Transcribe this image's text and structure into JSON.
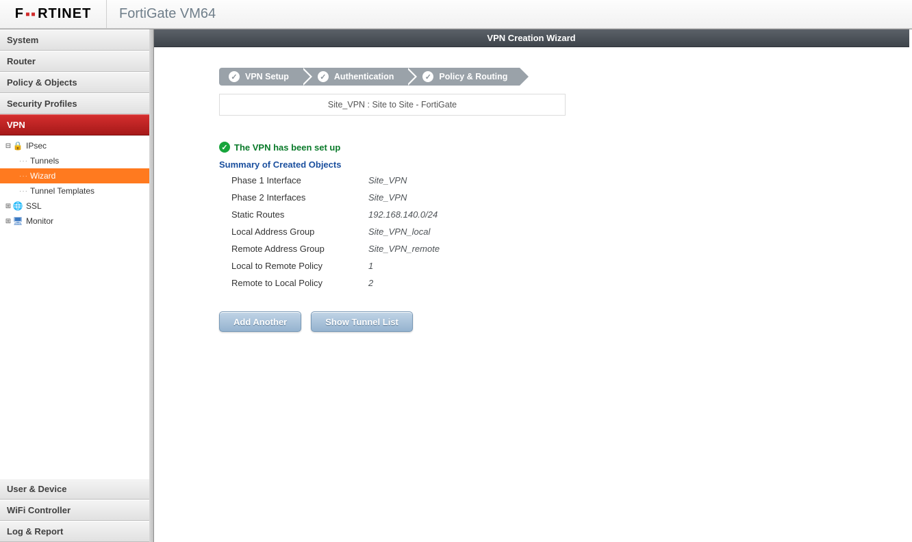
{
  "header": {
    "brand_prefix": "F",
    "brand_red": "▪▪",
    "brand_suffix": "RTINET",
    "product": "FortiGate VM64"
  },
  "sidebar": {
    "top": [
      "System",
      "Router",
      "Policy & Objects",
      "Security Profiles"
    ],
    "active": "VPN",
    "tree": {
      "ipsec": "IPsec",
      "tunnels": "Tunnels",
      "wizard": "Wizard",
      "templates": "Tunnel Templates",
      "ssl": "SSL",
      "monitor": "Monitor"
    },
    "bottom": [
      "User & Device",
      "WiFi Controller",
      "Log & Report"
    ]
  },
  "page": {
    "title": "VPN Creation Wizard",
    "steps": [
      "VPN Setup",
      "Authentication",
      "Policy & Routing"
    ],
    "info_line": "Site_VPN : Site to Site - FortiGate",
    "success": "The VPN has been set up",
    "summary_title": "Summary of Created Objects",
    "rows": {
      "phase1_k": "Phase 1 Interface",
      "phase1_v": "Site_VPN",
      "phase2_k": "Phase 2 Interfaces",
      "phase2_v": "Site_VPN",
      "routes_k": "Static Routes",
      "routes_v": "192.168.140.0/24",
      "lag_k": "Local Address Group",
      "lag_v": "Site_VPN_local",
      "rag_k": "Remote Address Group",
      "rag_v": "Site_VPN_remote",
      "lrp_k": "Local to Remote Policy",
      "lrp_v": "1",
      "rlp_k": "Remote to Local Policy",
      "rlp_v": "2"
    },
    "buttons": {
      "add": "Add Another",
      "list": "Show Tunnel List"
    }
  }
}
